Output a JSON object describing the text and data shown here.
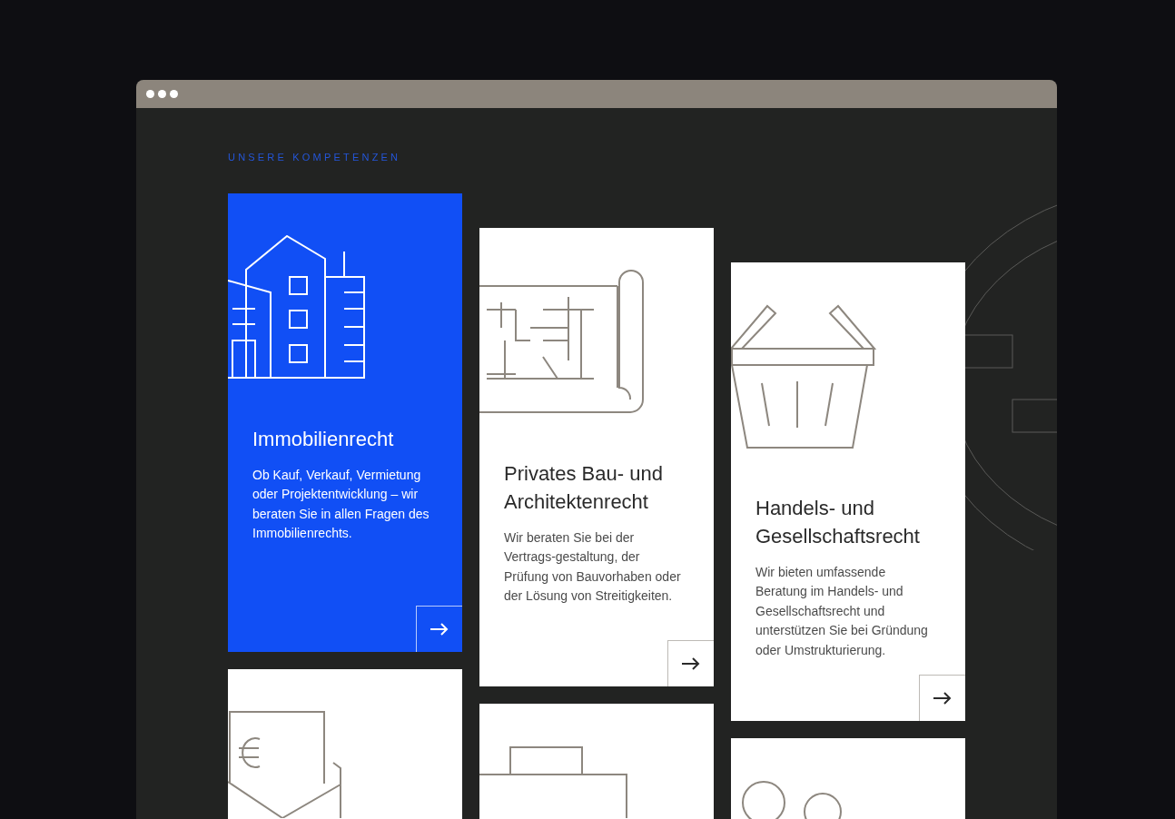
{
  "section_label": "UNSERE KOMPETENZEN",
  "cards": [
    {
      "title": "Immobilienrecht",
      "description": "Ob Kauf, Verkauf, Vermietung oder Projektentwicklung – wir beraten Sie in allen Fragen des Immobilienrechts.",
      "highlighted": true
    },
    {
      "title": "Privates Bau- und Architektenrecht",
      "description": "Wir beraten Sie bei der Vertrags-gestaltung, der Prüfung von Bauvorhaben oder der Lösung von Streitigkeiten.",
      "highlighted": false
    },
    {
      "title": "Handels- und Gesellschaftsrecht",
      "description": "Wir bieten umfassende Beratung im Handels- und Gesellschaftsrecht und unterstützen Sie bei Gründung oder Umstrukturierung.",
      "highlighted": false
    },
    {
      "highlighted": false
    },
    {
      "highlighted": false
    },
    {
      "highlighted": false
    }
  ]
}
